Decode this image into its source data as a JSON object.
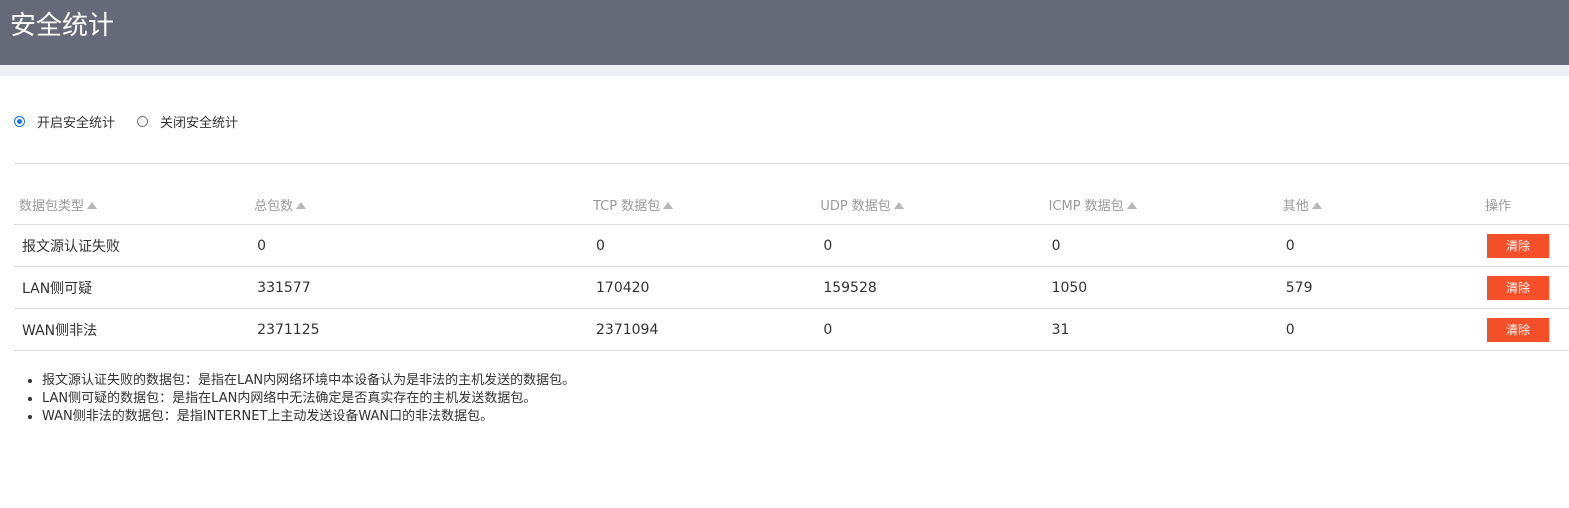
{
  "header": {
    "title": "安全统计"
  },
  "toggle": {
    "options": [
      {
        "label": "开启安全统计",
        "checked": true
      },
      {
        "label": "关闭安全统计",
        "checked": false
      }
    ]
  },
  "table": {
    "columns": [
      "数据包类型",
      "总包数",
      "TCP 数据包",
      "UDP 数据包",
      "ICMP 数据包",
      "其他",
      "操作"
    ],
    "rows": [
      {
        "type": "报文源认证失败",
        "total": "0",
        "tcp": "0",
        "udp": "0",
        "icmp": "0",
        "other": "0",
        "action": "清除"
      },
      {
        "type": "LAN侧可疑",
        "total": "331577",
        "tcp": "170420",
        "udp": "159528",
        "icmp": "1050",
        "other": "579",
        "action": "清除"
      },
      {
        "type": "WAN侧非法",
        "total": "2371125",
        "tcp": "2371094",
        "udp": "0",
        "icmp": "31",
        "other": "0",
        "action": "清除"
      }
    ]
  },
  "notes": [
    "报文源认证失败的数据包：是指在LAN内网络环境中本设备认为是非法的主机发送的数据包。",
    "LAN侧可疑的数据包：是指在LAN内网络中无法确定是否真实存在的主机发送数据包。",
    "WAN侧非法的数据包：是指INTERNET上主动发送设备WAN口的非法数据包。"
  ],
  "colors": {
    "header_bg": "#666977",
    "clear_button": "#f5502a",
    "radio_accent": "#1a73e8"
  }
}
